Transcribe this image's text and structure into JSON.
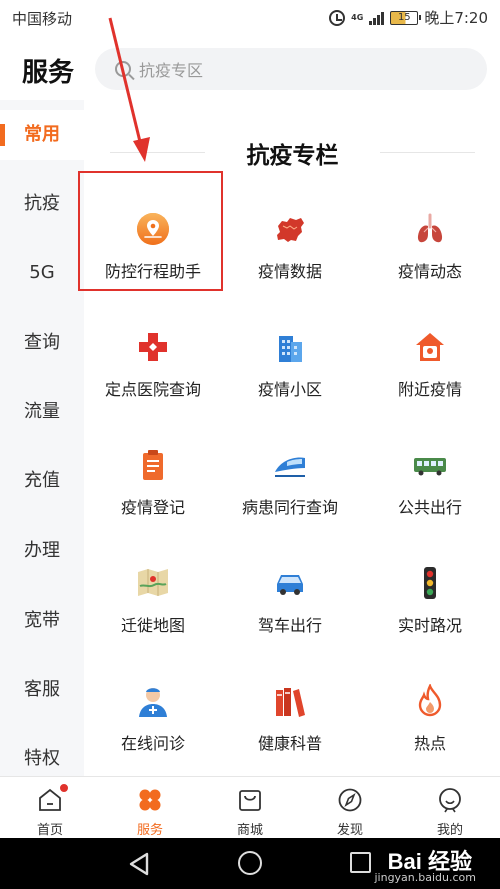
{
  "status_bar": {
    "carrier": "中国移动",
    "network": "4G",
    "battery": "15",
    "time": "晚上7:20"
  },
  "header": {
    "title": "服务",
    "search_placeholder": "抗疫专区"
  },
  "sidebar": {
    "items": [
      {
        "label": "常用",
        "active": true
      },
      {
        "label": "抗疫",
        "active": false
      },
      {
        "label": "5G",
        "active": false
      },
      {
        "label": "查询",
        "active": false
      },
      {
        "label": "流量",
        "active": false
      },
      {
        "label": "充值",
        "active": false
      },
      {
        "label": "办理",
        "active": false
      },
      {
        "label": "宽带",
        "active": false
      },
      {
        "label": "客服",
        "active": false
      },
      {
        "label": "特权",
        "active": false
      }
    ]
  },
  "section": {
    "title": "抗疫专栏"
  },
  "services": [
    {
      "label": "防控行程助手",
      "icon": "location-shield-icon"
    },
    {
      "label": "疫情数据",
      "icon": "china-map-icon"
    },
    {
      "label": "疫情动态",
      "icon": "lungs-icon"
    },
    {
      "label": "定点医院查询",
      "icon": "hospital-cross-icon"
    },
    {
      "label": "疫情小区",
      "icon": "building-icon"
    },
    {
      "label": "附近疫情",
      "icon": "home-alert-icon"
    },
    {
      "label": "疫情登记",
      "icon": "clipboard-icon"
    },
    {
      "label": "病患同行查询",
      "icon": "train-icon"
    },
    {
      "label": "公共出行",
      "icon": "bus-icon"
    },
    {
      "label": "迁徙地图",
      "icon": "folded-map-icon"
    },
    {
      "label": "驾车出行",
      "icon": "car-icon"
    },
    {
      "label": "实时路况",
      "icon": "traffic-light-icon"
    },
    {
      "label": "在线问诊",
      "icon": "doctor-icon"
    },
    {
      "label": "健康科普",
      "icon": "books-icon"
    },
    {
      "label": "热点",
      "icon": "flame-icon"
    }
  ],
  "tabbar": {
    "tabs": [
      {
        "label": "首页",
        "icon": "home-icon",
        "badge": true
      },
      {
        "label": "服务",
        "icon": "clover-icon",
        "active": true
      },
      {
        "label": "商城",
        "icon": "shopping-bag-icon"
      },
      {
        "label": "发现",
        "icon": "compass-icon"
      },
      {
        "label": "我的",
        "icon": "smile-icon"
      }
    ]
  },
  "watermark": {
    "brand": "Bai 经验",
    "url": "jingyan.baidu.com"
  },
  "colors": {
    "accent": "#f26b1f",
    "highlight": "#e0322c",
    "sidebar_bg": "#f6f7f9",
    "nav_bg": "#000000"
  }
}
